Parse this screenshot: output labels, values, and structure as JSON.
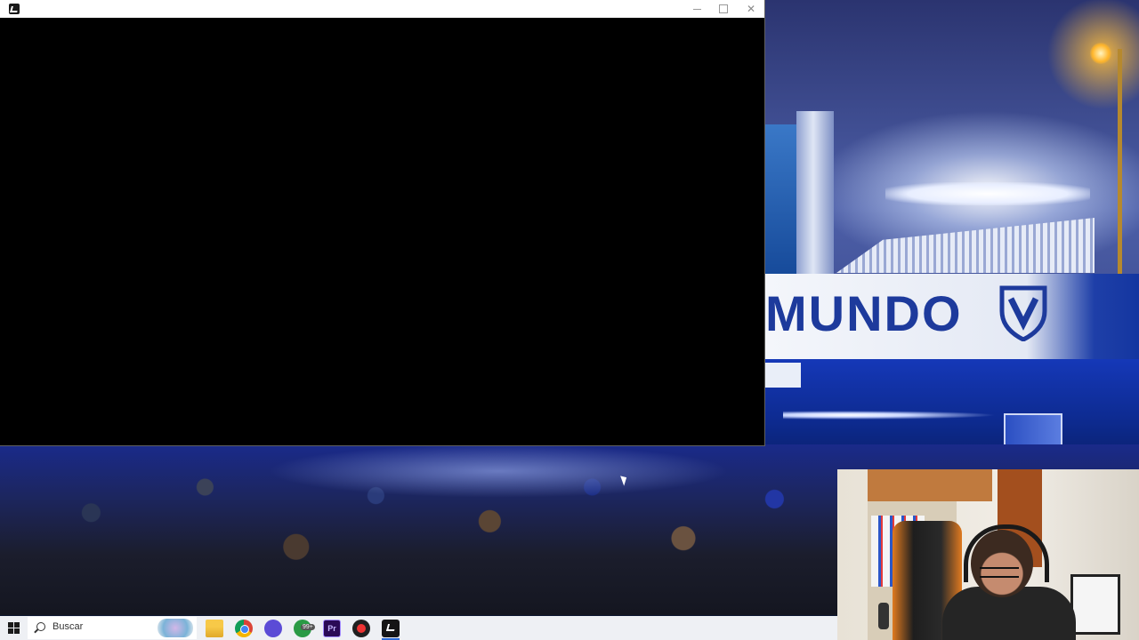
{
  "wallpaper": {
    "banner_text": "MUNDO",
    "colors": {
      "club_blue": "#1d3a9c",
      "wall_blue": "#1538b8"
    }
  },
  "window": {
    "title": "",
    "icon": "app-logo-icon",
    "controls": [
      "minimize-icon",
      "maximize-icon",
      "close-icon"
    ],
    "close_glyph": "✕"
  },
  "taskbar": {
    "start_icon": "windows-start-icon",
    "search_placeholder": "Buscar",
    "pinned": [
      {
        "name": "file-explorer-icon"
      },
      {
        "name": "chrome-icon"
      },
      {
        "name": "messenger-icon"
      },
      {
        "name": "whatsapp-icon",
        "badge": "99+"
      },
      {
        "name": "premiere-pro-icon",
        "label": "Pr"
      },
      {
        "name": "screen-recorder-icon"
      },
      {
        "name": "app-logo-icon",
        "active": true
      }
    ]
  }
}
